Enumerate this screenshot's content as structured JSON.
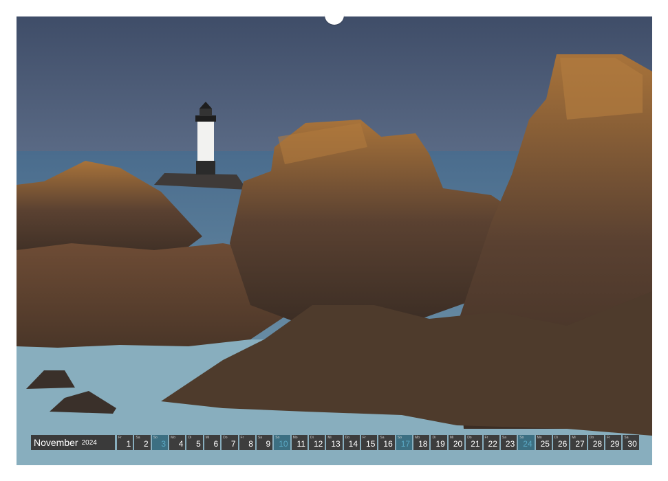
{
  "calendar": {
    "month": "November",
    "year": "2024",
    "days": [
      {
        "dow": "Fr",
        "num": "1",
        "sunday": false
      },
      {
        "dow": "Sa",
        "num": "2",
        "sunday": false
      },
      {
        "dow": "So",
        "num": "3",
        "sunday": true
      },
      {
        "dow": "Mo",
        "num": "4",
        "sunday": false
      },
      {
        "dow": "Di",
        "num": "5",
        "sunday": false
      },
      {
        "dow": "Mi",
        "num": "6",
        "sunday": false
      },
      {
        "dow": "Do",
        "num": "7",
        "sunday": false
      },
      {
        "dow": "Fr",
        "num": "8",
        "sunday": false
      },
      {
        "dow": "Sa",
        "num": "9",
        "sunday": false
      },
      {
        "dow": "So",
        "num": "10",
        "sunday": true
      },
      {
        "dow": "Mo",
        "num": "11",
        "sunday": false
      },
      {
        "dow": "Di",
        "num": "12",
        "sunday": false
      },
      {
        "dow": "Mi",
        "num": "13",
        "sunday": false
      },
      {
        "dow": "Do",
        "num": "14",
        "sunday": false
      },
      {
        "dow": "Fr",
        "num": "15",
        "sunday": false
      },
      {
        "dow": "Sa",
        "num": "16",
        "sunday": false
      },
      {
        "dow": "So",
        "num": "17",
        "sunday": true
      },
      {
        "dow": "Mo",
        "num": "18",
        "sunday": false
      },
      {
        "dow": "Di",
        "num": "19",
        "sunday": false
      },
      {
        "dow": "Mi",
        "num": "20",
        "sunday": false
      },
      {
        "dow": "Do",
        "num": "21",
        "sunday": false
      },
      {
        "dow": "Fr",
        "num": "22",
        "sunday": false
      },
      {
        "dow": "Sa",
        "num": "23",
        "sunday": false
      },
      {
        "dow": "So",
        "num": "24",
        "sunday": true
      },
      {
        "dow": "Mo",
        "num": "25",
        "sunday": false
      },
      {
        "dow": "Di",
        "num": "26",
        "sunday": false
      },
      {
        "dow": "Mi",
        "num": "27",
        "sunday": false
      },
      {
        "dow": "Do",
        "num": "28",
        "sunday": false
      },
      {
        "dow": "Fr",
        "num": "29",
        "sunday": false
      },
      {
        "dow": "Sa",
        "num": "30",
        "sunday": false
      }
    ]
  },
  "colors": {
    "day_cell": "#3d3d3d",
    "sunday_cell": "#3c6f82",
    "sunday_number": "#5aa8c4",
    "month_cell": "#3a3a3a"
  },
  "photo": {
    "subject": "lighthouse-on-rocky-coast"
  }
}
